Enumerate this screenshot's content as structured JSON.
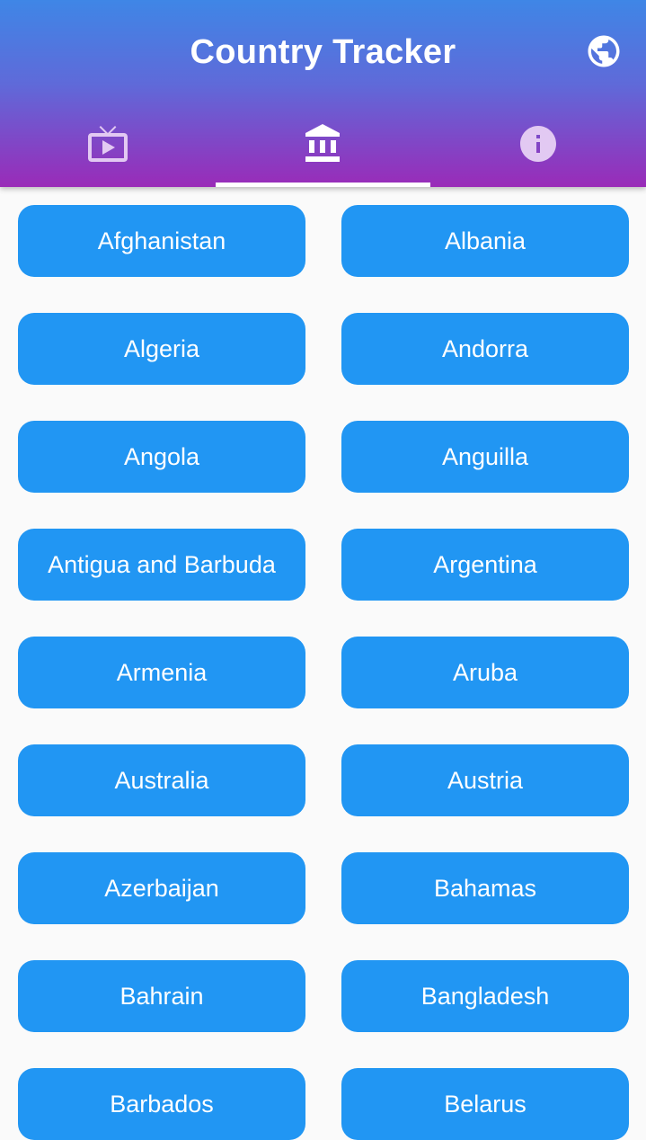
{
  "app_bar": {
    "title": "Country Tracker",
    "action_icon": "globe-icon",
    "colors": {
      "gradient_top": "#3f86e6",
      "gradient_bottom": "#9a2bb8",
      "tab_inactive": "#e2c9f2",
      "indicator": "#ffffff"
    }
  },
  "tabs": [
    {
      "icon": "live-tv-icon",
      "selected": false
    },
    {
      "icon": "bank-icon",
      "selected": true
    },
    {
      "icon": "info-icon",
      "selected": false
    }
  ],
  "country_button_color": "#2196f3",
  "countries": [
    "Afghanistan",
    "Albania",
    "Algeria",
    "Andorra",
    "Angola",
    "Anguilla",
    "Antigua and Barbuda",
    "Argentina",
    "Armenia",
    "Aruba",
    "Australia",
    "Austria",
    "Azerbaijan",
    "Bahamas",
    "Bahrain",
    "Bangladesh",
    "Barbados",
    "Belarus"
  ]
}
